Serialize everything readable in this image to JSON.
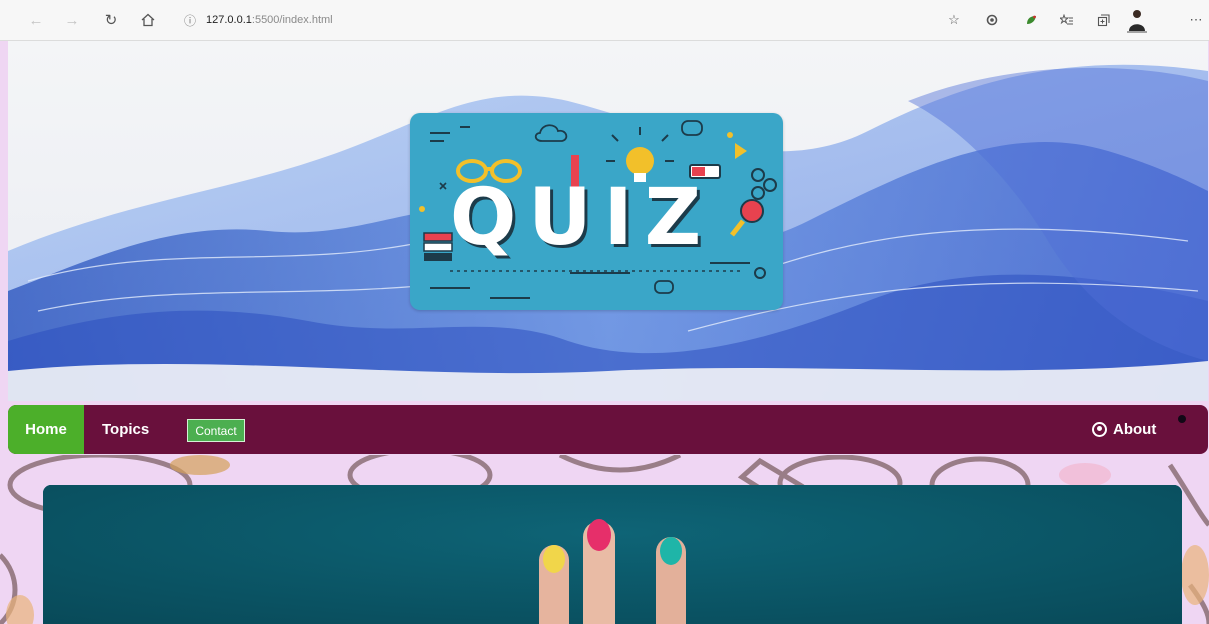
{
  "browser": {
    "url_host": "127.0.0.1",
    "url_path": ":5500/index.html",
    "icons": {
      "back": "arrow-left-icon",
      "forward": "arrow-right-icon",
      "reload": "refresh-icon",
      "home": "home-icon",
      "info": "info-icon",
      "favorite": "star-icon",
      "extension1": "extension-icon",
      "extension2": "leaf-extension-icon",
      "favorites": "favorites-list-icon",
      "collections": "collections-icon",
      "profile": "profile-icon",
      "menu": "more-icon"
    }
  },
  "hero": {
    "logo_text": "QUIZ"
  },
  "navbar": {
    "home": "Home",
    "topics": "Topics",
    "contact": "Contact",
    "about": "About",
    "colors": {
      "bar": "#69103c",
      "home_active": "#4caf2a",
      "contact_button": "#4caf50"
    }
  }
}
